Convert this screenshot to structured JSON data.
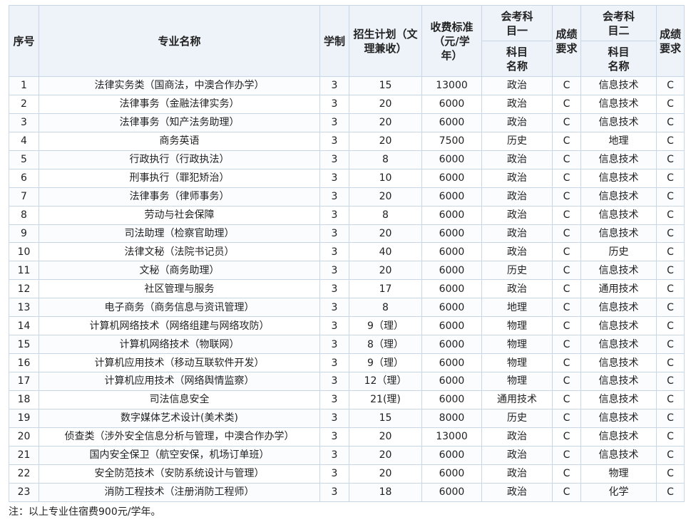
{
  "header": {
    "seq": "序号",
    "major": "专业名称",
    "duration": "学制",
    "plan": "招生计划（文理兼收）",
    "fee": "收费标准（元/学年）",
    "subj1_group": "会考科目一",
    "subj1_name": "科目名称",
    "subj1_req": "成绩要求",
    "subj2_group": "会考科目二",
    "subj2_name": "科目名称",
    "subj2_req": "成绩要求"
  },
  "rows": [
    {
      "seq": "1",
      "major": "法律实务类（国商法，中澳合作办学）",
      "duration": "3",
      "plan": "15",
      "fee": "13000",
      "s1": "政治",
      "r1": "C",
      "s2": "信息技术",
      "r2": "C"
    },
    {
      "seq": "2",
      "major": "法律事务（金融法律实务）",
      "duration": "3",
      "plan": "20",
      "fee": "6000",
      "s1": "政治",
      "r1": "C",
      "s2": "信息技术",
      "r2": "C"
    },
    {
      "seq": "3",
      "major": "法律事务（知产法务助理）",
      "duration": "3",
      "plan": "20",
      "fee": "6000",
      "s1": "政治",
      "r1": "C",
      "s2": "信息技术",
      "r2": "C"
    },
    {
      "seq": "4",
      "major": "商务英语",
      "duration": "3",
      "plan": "20",
      "fee": "7500",
      "s1": "历史",
      "r1": "C",
      "s2": "地理",
      "r2": "C"
    },
    {
      "seq": "5",
      "major": "行政执行（行政执法）",
      "duration": "3",
      "plan": "8",
      "fee": "6000",
      "s1": "政治",
      "r1": "C",
      "s2": "信息技术",
      "r2": "C"
    },
    {
      "seq": "6",
      "major": "刑事执行（罪犯矫治）",
      "duration": "3",
      "plan": "10",
      "fee": "6000",
      "s1": "政治",
      "r1": "C",
      "s2": "信息技术",
      "r2": "C"
    },
    {
      "seq": "7",
      "major": "法律事务（律师事务）",
      "duration": "3",
      "plan": "20",
      "fee": "6000",
      "s1": "政治",
      "r1": "C",
      "s2": "信息技术",
      "r2": "C"
    },
    {
      "seq": "8",
      "major": "劳动与社会保障",
      "duration": "3",
      "plan": "8",
      "fee": "6000",
      "s1": "政治",
      "r1": "C",
      "s2": "信息技术",
      "r2": "C"
    },
    {
      "seq": "9",
      "major": "司法助理（检察官助理）",
      "duration": "3",
      "plan": "20",
      "fee": "6000",
      "s1": "政治",
      "r1": "C",
      "s2": "信息技术",
      "r2": "C"
    },
    {
      "seq": "10",
      "major": "法律文秘（法院书记员）",
      "duration": "3",
      "plan": "40",
      "fee": "6000",
      "s1": "政治",
      "r1": "C",
      "s2": "历史",
      "r2": "C"
    },
    {
      "seq": "11",
      "major": "文秘（商务助理）",
      "duration": "3",
      "plan": "20",
      "fee": "6000",
      "s1": "历史",
      "r1": "C",
      "s2": "信息技术",
      "r2": "C"
    },
    {
      "seq": "12",
      "major": "社区管理与服务",
      "duration": "3",
      "plan": "17",
      "fee": "6000",
      "s1": "政治",
      "r1": "C",
      "s2": "通用技术",
      "r2": "C"
    },
    {
      "seq": "13",
      "major": "电子商务（商务信息与资讯管理）",
      "duration": "3",
      "plan": "8",
      "fee": "6000",
      "s1": "地理",
      "r1": "C",
      "s2": "信息技术",
      "r2": "C"
    },
    {
      "seq": "14",
      "major": "计算机网络技术（网络组建与网络攻防）",
      "duration": "3",
      "plan": "9（理）",
      "fee": "6000",
      "s1": "物理",
      "r1": "C",
      "s2": "信息技术",
      "r2": "C"
    },
    {
      "seq": "15",
      "major": "计算机网络技术（物联网）",
      "duration": "3",
      "plan": "8（理）",
      "fee": "6000",
      "s1": "物理",
      "r1": "C",
      "s2": "信息技术",
      "r2": "C"
    },
    {
      "seq": "16",
      "major": "计算机应用技术（移动互联软件开发）",
      "duration": "3",
      "plan": "9（理）",
      "fee": "6000",
      "s1": "物理",
      "r1": "C",
      "s2": "信息技术",
      "r2": "C"
    },
    {
      "seq": "17",
      "major": "计算机应用技术（网络舆情监察）",
      "duration": "3",
      "plan": "12（理）",
      "fee": "6000",
      "s1": "物理",
      "r1": "C",
      "s2": "信息技术",
      "r2": "C"
    },
    {
      "seq": "18",
      "major": "司法信息安全",
      "duration": "3",
      "plan": "21(理)",
      "fee": "6000",
      "s1": "通用技术",
      "r1": "C",
      "s2": "信息技术",
      "r2": "C"
    },
    {
      "seq": "19",
      "major": "数字媒体艺术设计(美术类)",
      "duration": "3",
      "plan": "15",
      "fee": "8000",
      "s1": "历史",
      "r1": "C",
      "s2": "信息技术",
      "r2": "C"
    },
    {
      "seq": "20",
      "major": "侦查类（涉外安全信息分析与管理，中澳合作办学）",
      "duration": "3",
      "plan": "20",
      "fee": "13000",
      "s1": "政治",
      "r1": "C",
      "s2": "信息技术",
      "r2": "C"
    },
    {
      "seq": "21",
      "major": "国内安全保卫（航空安保，机场订单班）",
      "duration": "3",
      "plan": "20",
      "fee": "6000",
      "s1": "政治",
      "r1": "C",
      "s2": "信息技术",
      "r2": "C"
    },
    {
      "seq": "22",
      "major": "安全防范技术（安防系统设计与管理）",
      "duration": "3",
      "plan": "20",
      "fee": "6000",
      "s1": "政治",
      "r1": "C",
      "s2": "物理",
      "r2": "C"
    },
    {
      "seq": "23",
      "major": "消防工程技术（注册消防工程师）",
      "duration": "3",
      "plan": "18",
      "fee": "6000",
      "s1": "政治",
      "r1": "C",
      "s2": "化学",
      "r2": "C"
    }
  ],
  "note": "注：以上专业住宿费900元/学年。"
}
